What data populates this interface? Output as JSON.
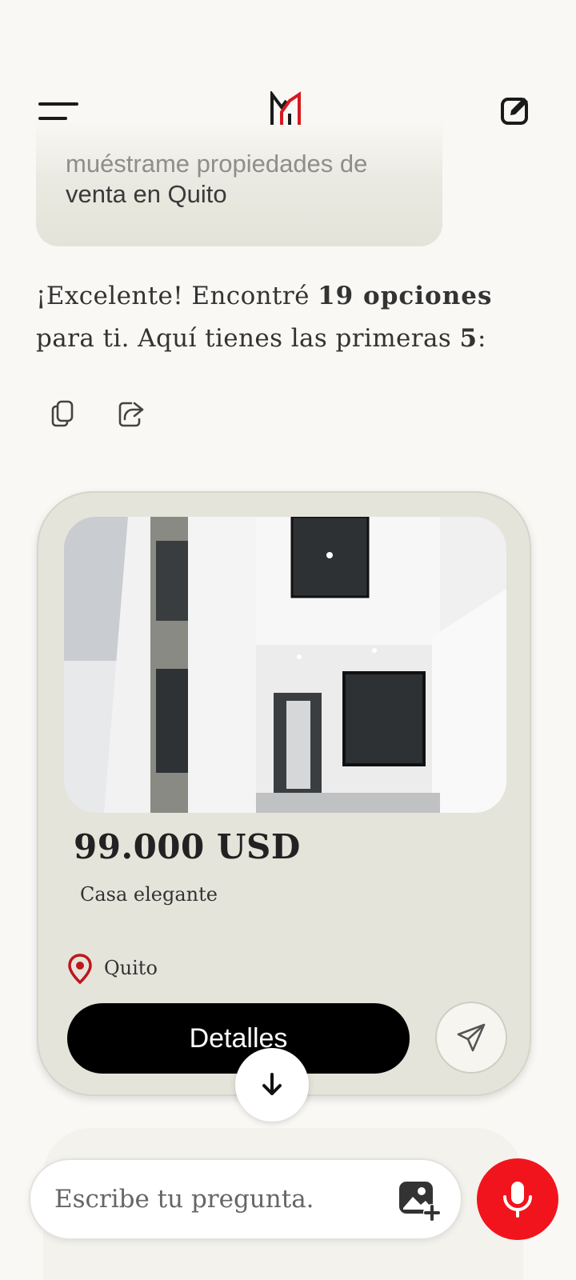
{
  "header": {
    "menu_icon": "hamburger-menu-icon",
    "logo_icon": "brand-logo-m",
    "edit_icon": "new-chat-edit-icon"
  },
  "user_message": {
    "line1": "muéstrame propiedades de",
    "line2": "venta en Quito"
  },
  "assistant_reply": {
    "part1": "¡Excelente! Encontré ",
    "count_bold": "19 opciones",
    "part2": " para ti. Aquí tienes las primeras ",
    "first_n": "5",
    "part3": ":"
  },
  "actions": {
    "copy_icon": "copy-icon",
    "share_icon": "share-icon"
  },
  "property_card": {
    "price": "99.000 USD",
    "type": "Casa elegante",
    "location": "Quito",
    "details_label": "Detalles",
    "send_icon": "paper-plane-icon",
    "photo_alt": "Fachada de casa blanca de dos pisos"
  },
  "input": {
    "placeholder": "Escribe tu pregunta.",
    "image_icon": "add-image-icon",
    "mic_icon": "microphone-icon"
  },
  "colors": {
    "accent": "#f2141c",
    "card_bg": "#e5e4da",
    "background": "#f9f8f5",
    "logo_red": "#d71920"
  }
}
